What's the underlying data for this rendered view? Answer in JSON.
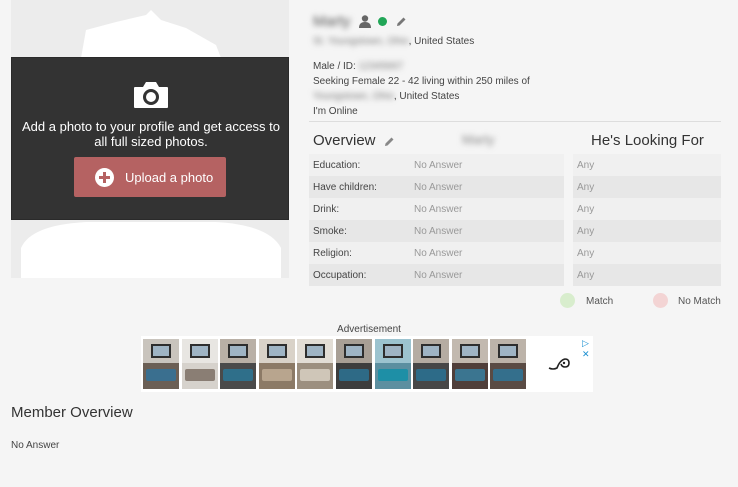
{
  "profile": {
    "username": "Marty",
    "location": "St. Youngstown, Ohio, United States",
    "location_visible": ", United States",
    "location_hidden": "St. Youngstown, Ohio",
    "gender_label": "Male / ID:",
    "member_id": "12345667",
    "seeking_line": "Seeking Female 22 - 42 living within 250 miles of",
    "seeking_city_hidden": "Youngstown, Ohio",
    "seeking_city_visible": ", United States",
    "online_status": "I'm Online",
    "online_color": "#21a657"
  },
  "photo": {
    "prompt": "Add a photo to your profile and get access to all full sized photos.",
    "upload_label": "Upload a photo",
    "upload_color": "#b56262",
    "icon": "camera-icon"
  },
  "overview": {
    "title": "Overview",
    "name_column": "Marty",
    "looking_for_title": "He's Looking For",
    "rows": [
      {
        "label": "Education:",
        "answer": "No Answer",
        "want": "Any"
      },
      {
        "label": "Have children:",
        "answer": "No Answer",
        "want": "Any"
      },
      {
        "label": "Drink:",
        "answer": "No Answer",
        "want": "Any"
      },
      {
        "label": "Smoke:",
        "answer": "No Answer",
        "want": "Any"
      },
      {
        "label": "Religion:",
        "answer": "No Answer",
        "want": "Any"
      },
      {
        "label": "Occupation:",
        "answer": "No Answer",
        "want": "Any"
      }
    ]
  },
  "legend": {
    "match_label": "Match",
    "match_color": "#d8edcd",
    "no_match_label": "No Match",
    "no_match_color": "#f3d4d4"
  },
  "ad": {
    "label": "Advertisement",
    "choices": "▷ ✕"
  },
  "member_overview": {
    "title": "Member Overview",
    "text": "No Answer"
  }
}
